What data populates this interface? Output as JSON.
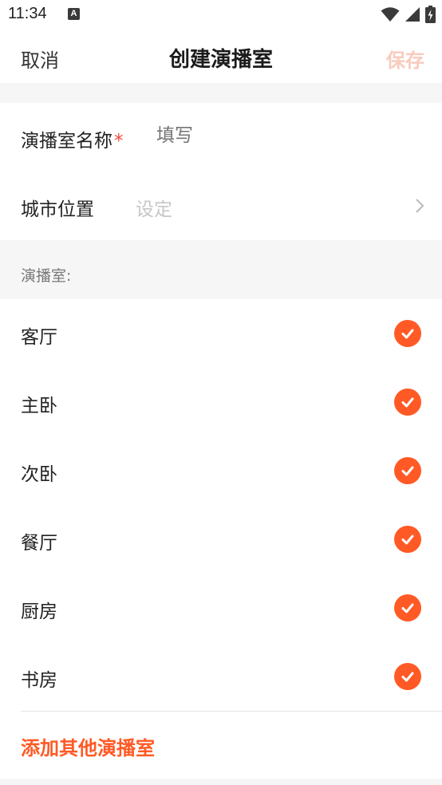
{
  "status_bar": {
    "time": "11:34",
    "notification_badge": "A",
    "icons": [
      "wifi-icon",
      "signal-icon",
      "battery-icon"
    ]
  },
  "nav": {
    "cancel_label": "取消",
    "title": "创建演播室",
    "save_label": "保存"
  },
  "form": {
    "name_label": "演播室名称",
    "required_mark": "*",
    "name_placeholder": "填写",
    "city_label": "城市位置",
    "city_value": "设定"
  },
  "rooms": {
    "section_title": "演播室:",
    "items": [
      {
        "label": "客厅",
        "checked": true
      },
      {
        "label": "主卧",
        "checked": true
      },
      {
        "label": "次卧",
        "checked": true
      },
      {
        "label": "餐厅",
        "checked": true
      },
      {
        "label": "厨房",
        "checked": true
      },
      {
        "label": "书房",
        "checked": true
      }
    ],
    "add_label": "添加其他演播室"
  },
  "colors": {
    "accent": "#ff5a26",
    "save_disabled": "#f8cbbd",
    "required": "#f04a3a",
    "placeholder": "#c6c6c6",
    "section_bg": "#f6f6f6"
  }
}
